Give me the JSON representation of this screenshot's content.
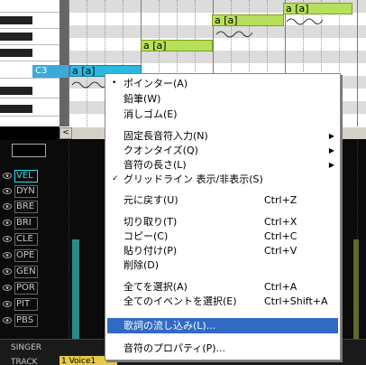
{
  "piano_roll": {
    "key_label": "C3",
    "notes": [
      {
        "lyric": "a [a]",
        "selected": true
      },
      {
        "lyric": "a [a]",
        "selected": false
      },
      {
        "lyric": "a [a]",
        "selected": false
      },
      {
        "lyric": "a [a]",
        "selected": false
      }
    ]
  },
  "controls": [
    {
      "label": "VEL",
      "active": true
    },
    {
      "label": "DYN",
      "active": false
    },
    {
      "label": "BRE",
      "active": false
    },
    {
      "label": "BRI",
      "active": false
    },
    {
      "label": "CLE",
      "active": false
    },
    {
      "label": "OPE",
      "active": false
    },
    {
      "label": "GEN",
      "active": false
    },
    {
      "label": "POR",
      "active": false
    },
    {
      "label": "PIT",
      "active": false
    },
    {
      "label": "PBS",
      "active": false
    }
  ],
  "bottom": {
    "singer": "SINGER",
    "track": "TRACK",
    "voice_tab": "1 Voice1"
  },
  "scrollbar": {
    "left_arrow": "<"
  },
  "menu": {
    "items": [
      {
        "label": "ポインター(A)",
        "shortcut": "",
        "mark": "•",
        "submenu": false
      },
      {
        "label": "鉛筆(W)",
        "shortcut": "",
        "mark": "",
        "submenu": false
      },
      {
        "label": "消しゴム(E)",
        "shortcut": "",
        "mark": "",
        "submenu": false
      },
      {
        "label": "固定長音符入力(N)",
        "shortcut": "",
        "mark": "",
        "submenu": true
      },
      {
        "label": "クオンタイズ(Q)",
        "shortcut": "",
        "mark": "",
        "submenu": true
      },
      {
        "label": "音符の長さ(L)",
        "shortcut": "",
        "mark": "",
        "submenu": true
      },
      {
        "label": "グリッドライン 表示/非表示(S)",
        "shortcut": "",
        "mark": "✓",
        "submenu": false
      },
      {
        "label": "元に戻す(U)",
        "shortcut": "Ctrl+Z",
        "mark": "",
        "submenu": false
      },
      {
        "label": "切り取り(T)",
        "shortcut": "Ctrl+X",
        "mark": "",
        "submenu": false
      },
      {
        "label": "コピー(C)",
        "shortcut": "Ctrl+C",
        "mark": "",
        "submenu": false
      },
      {
        "label": "貼り付け(P)",
        "shortcut": "Ctrl+V",
        "mark": "",
        "submenu": false
      },
      {
        "label": "削除(D)",
        "shortcut": "",
        "mark": "",
        "submenu": false
      },
      {
        "label": "全てを選択(A)",
        "shortcut": "Ctrl+A",
        "mark": "",
        "submenu": false
      },
      {
        "label": "全てのイベントを選択(E)",
        "shortcut": "Ctrl+Shift+A",
        "mark": "",
        "submenu": false
      },
      {
        "label": "歌詞の流し込み(L)...",
        "shortcut": "",
        "mark": "",
        "submenu": false,
        "highlighted": true
      },
      {
        "label": "音符のプロパティ(P)...",
        "shortcut": "",
        "mark": "",
        "submenu": false
      }
    ]
  }
}
